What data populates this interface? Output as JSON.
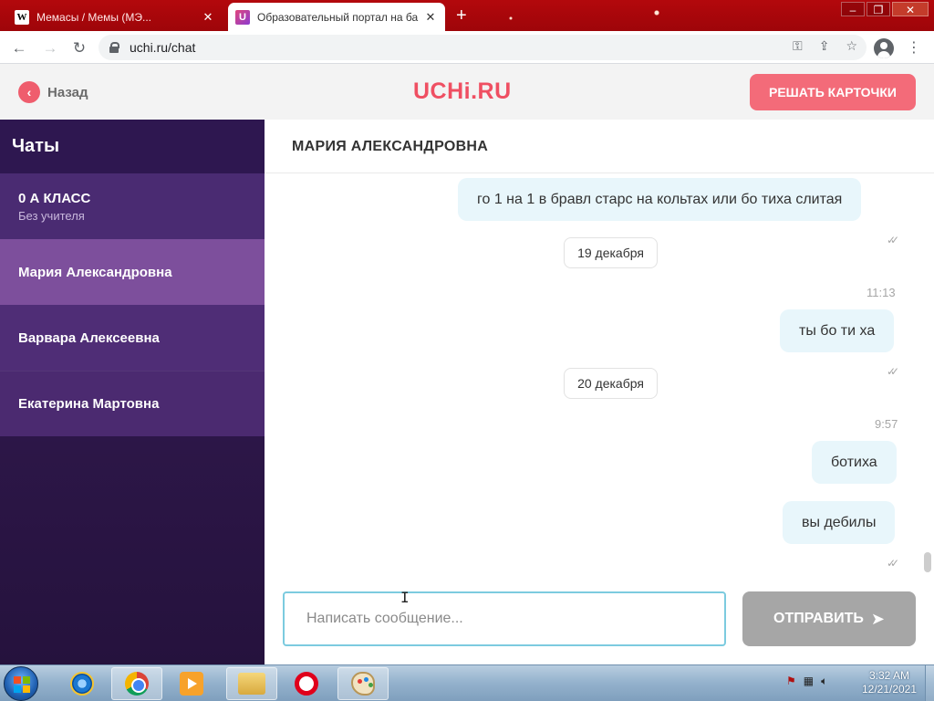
{
  "browser": {
    "tabs": [
      {
        "title": "Мемасы / Мемы (МЭ...",
        "active": false,
        "favicon": "W"
      },
      {
        "title": "Образовательный портал на ба",
        "active": true,
        "favicon": "U"
      }
    ],
    "new_tab": "+",
    "url": "uchi.ru/chat"
  },
  "site": {
    "back_label": "Назад",
    "logo": "UCHi.RU",
    "cards_button": "РЕШАТЬ КАРТОЧКИ"
  },
  "sidebar": {
    "title": "Чаты",
    "items": [
      {
        "name": "0 А КЛАСС",
        "subtitle": "Без учителя"
      },
      {
        "name": "Мария Александровна",
        "selected": true
      },
      {
        "name": "Варвара Алексеевна"
      },
      {
        "name": "Екатерина Мартовна"
      }
    ]
  },
  "chat": {
    "header": "МАРИЯ АЛЕКСАНДРОВНА",
    "messages": [
      {
        "text": "го 1 на 1 в бравл старс на кольтах или бо тиха слитая"
      },
      {
        "date": "19 декабря"
      },
      {
        "time": "11:13"
      },
      {
        "text": "ты бо ти ха"
      },
      {
        "date": "20 декабря"
      },
      {
        "time": "9:57"
      },
      {
        "text": "ботиха"
      },
      {
        "text": "вы дебилы"
      }
    ],
    "read_ticks": "✓✓",
    "input_placeholder": "Написать сообщение...",
    "send_label": "ОТПРАВИТЬ"
  },
  "taskbar": {
    "time": "3:32 AM",
    "date": "12/21/2021"
  },
  "colors": {
    "brand": "#ef4f62",
    "sidebar_bg": "#2c1647",
    "sidebar_selected": "#7d4f9c",
    "bubble": "#e8f6fb",
    "input_border": "#7ccbdf",
    "send_disabled": "#a6a6a6"
  }
}
